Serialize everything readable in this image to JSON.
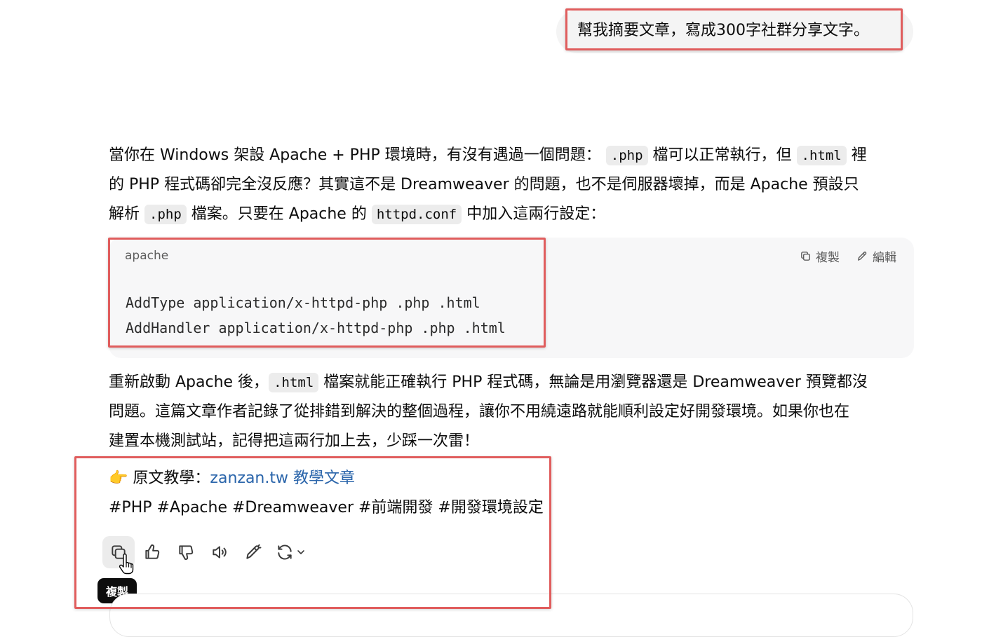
{
  "user_message": "幫我摘要文章，寫成300字社群分享文字。",
  "response": {
    "p1": {
      "l1_a": "當你在 Windows 架設 Apache + PHP 環境時，有沒有遇過一個問題：",
      "c1": ".php",
      "l1_b": "檔可以正常執行，但",
      "c2": ".html",
      "l1_c": "裡",
      "l2": "的 PHP 程式碼卻完全沒反應？其實這不是 Dreamweaver 的問題，也不是伺服器壞掉，而是 Apache 預設只",
      "l3_a": "解析",
      "c3": ".php",
      "l3_b": "檔案。只要在 Apache 的",
      "c4": "httpd.conf",
      "l3_c": "中加入這兩行設定："
    },
    "code": {
      "language": "apache",
      "copy_label": "複製",
      "edit_label": "編輯",
      "line1": "AddType application/x-httpd-php .php .html",
      "line2": "AddHandler application/x-httpd-php .php .html"
    },
    "p2": {
      "l1_a": "重新啟動 Apache 後，",
      "c1": ".html",
      "l1_b": "檔案就能正確執行 PHP 程式碼，無論是用瀏覽器還是 Dreamweaver 預覽都沒",
      "l2": "問題。這篇文章作者記錄了從排錯到解決的整個過程，讓你不用繞遠路就能順利設定好開發環境。如果你也在",
      "l3": "建置本機測試站，記得把這兩行加上去，少踩一次雷！"
    },
    "source_emoji": "👉",
    "source_label": "原文教學：",
    "source_link": "zanzan.tw 教學文章",
    "tags": "#PHP #Apache #Dreamweaver #前端開發 #開發環境設定"
  },
  "actions": {
    "icons": [
      "copy-icon",
      "thumbs-up-icon",
      "thumbs-down-icon",
      "speaker-icon",
      "edit-pen-icon",
      "regenerate-icon"
    ],
    "tooltip": "複製"
  },
  "colors": {
    "highlight_border": "#e05d5d",
    "link": "#2964aa",
    "code_bg": "#f7f7f8",
    "inline_code_bg": "#ececec",
    "bubble_bg": "#f4f4f4"
  }
}
